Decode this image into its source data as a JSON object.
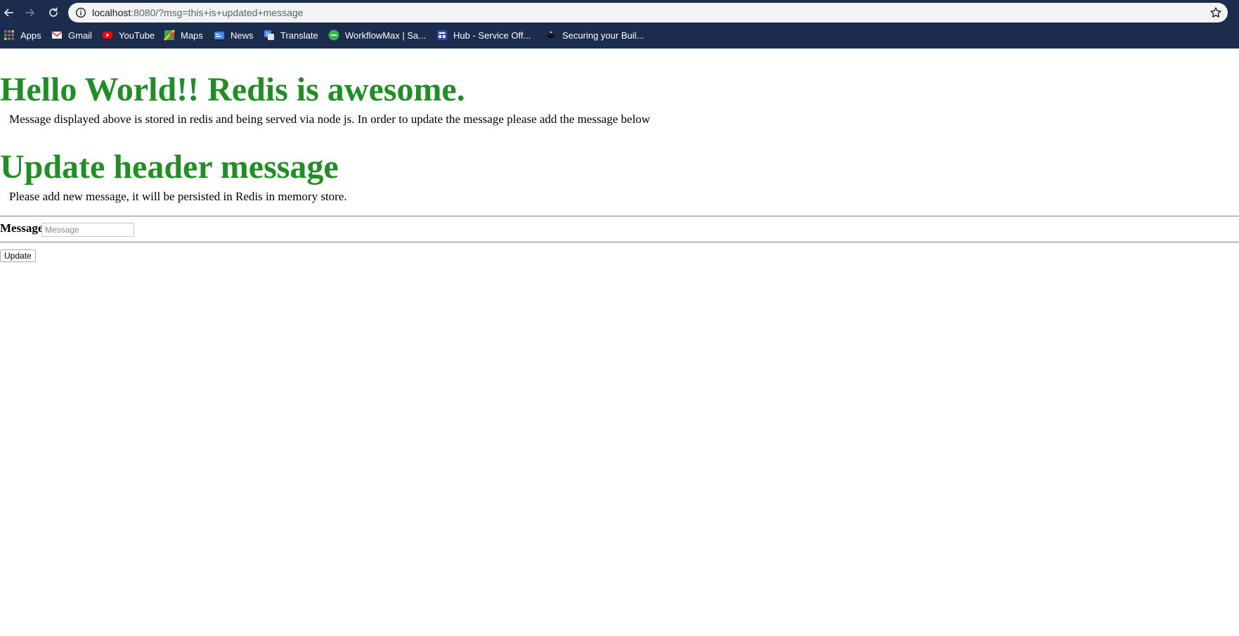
{
  "browser": {
    "url_host": "localhost",
    "url_path": ":8080/?msg=this+is+updated+message",
    "bookmarks": [
      {
        "label": "Apps",
        "icon": "apps-grid-icon"
      },
      {
        "label": "Gmail",
        "icon": "gmail-icon"
      },
      {
        "label": "YouTube",
        "icon": "youtube-icon"
      },
      {
        "label": "Maps",
        "icon": "maps-icon"
      },
      {
        "label": "News",
        "icon": "news-icon"
      },
      {
        "label": "Translate",
        "icon": "translate-icon"
      },
      {
        "label": "WorkflowMax | Sa...",
        "icon": "workflowmax-icon"
      },
      {
        "label": "Hub - Service Off...",
        "icon": "hub-icon"
      },
      {
        "label": "Securing your Buil...",
        "icon": "securing-icon"
      }
    ]
  },
  "colors": {
    "chrome_bg": "#1c2c4d",
    "heading_green": "#1f8f23"
  },
  "main": {
    "heading": "Hello World!! Redis is awesome.",
    "description": "Message displayed above is stored in redis and being served via node js. In order to update the message please add the message below"
  },
  "update": {
    "heading": "Update header message",
    "description": "Please add new message, it will be persisted in Redis in memory store.",
    "field_label": "Message",
    "field_placeholder": "Message",
    "field_value": "",
    "button_label": "Update"
  }
}
